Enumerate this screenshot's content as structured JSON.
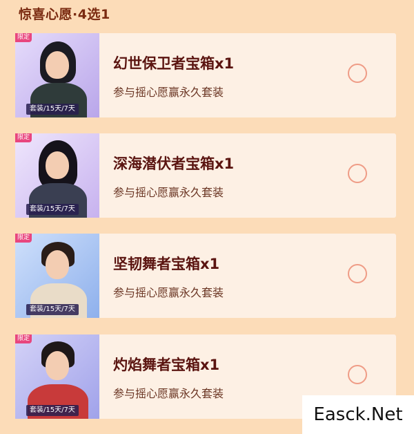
{
  "header": {
    "title": "惊喜心愿·4选1"
  },
  "options": [
    {
      "title": "幻世保卫者宝箱x1",
      "desc": "参与摇心愿赢永久套装",
      "limited": "限定",
      "tag": "套装/15天/7天",
      "bg": "#c8b8ee",
      "hair": "#1b1b22",
      "torso": "#2f3b3a"
    },
    {
      "title": "深海潜伏者宝箱x1",
      "desc": "参与摇心愿赢永久套装",
      "limited": "限定",
      "tag": "套装/15天/7天",
      "bg": "#d7c6f4",
      "hair": "#15121a",
      "torso": "#3a3f52"
    },
    {
      "title": "坚韧舞者宝箱x1",
      "desc": "参与摇心愿赢永久套装",
      "limited": "限定",
      "tag": "套装/15天/7天",
      "bg": "#9fbdf0",
      "hair": "#2a1d18",
      "torso": "#e9dcc8"
    },
    {
      "title": "灼焰舞者宝箱x1",
      "desc": "参与摇心愿赢永久套装",
      "limited": "限定",
      "tag": "套装/15天/7天",
      "bg": "#b4b6ef",
      "hair": "#1e1818",
      "torso": "#c83a3a"
    }
  ],
  "watermark": {
    "text": "Easck.Net"
  }
}
